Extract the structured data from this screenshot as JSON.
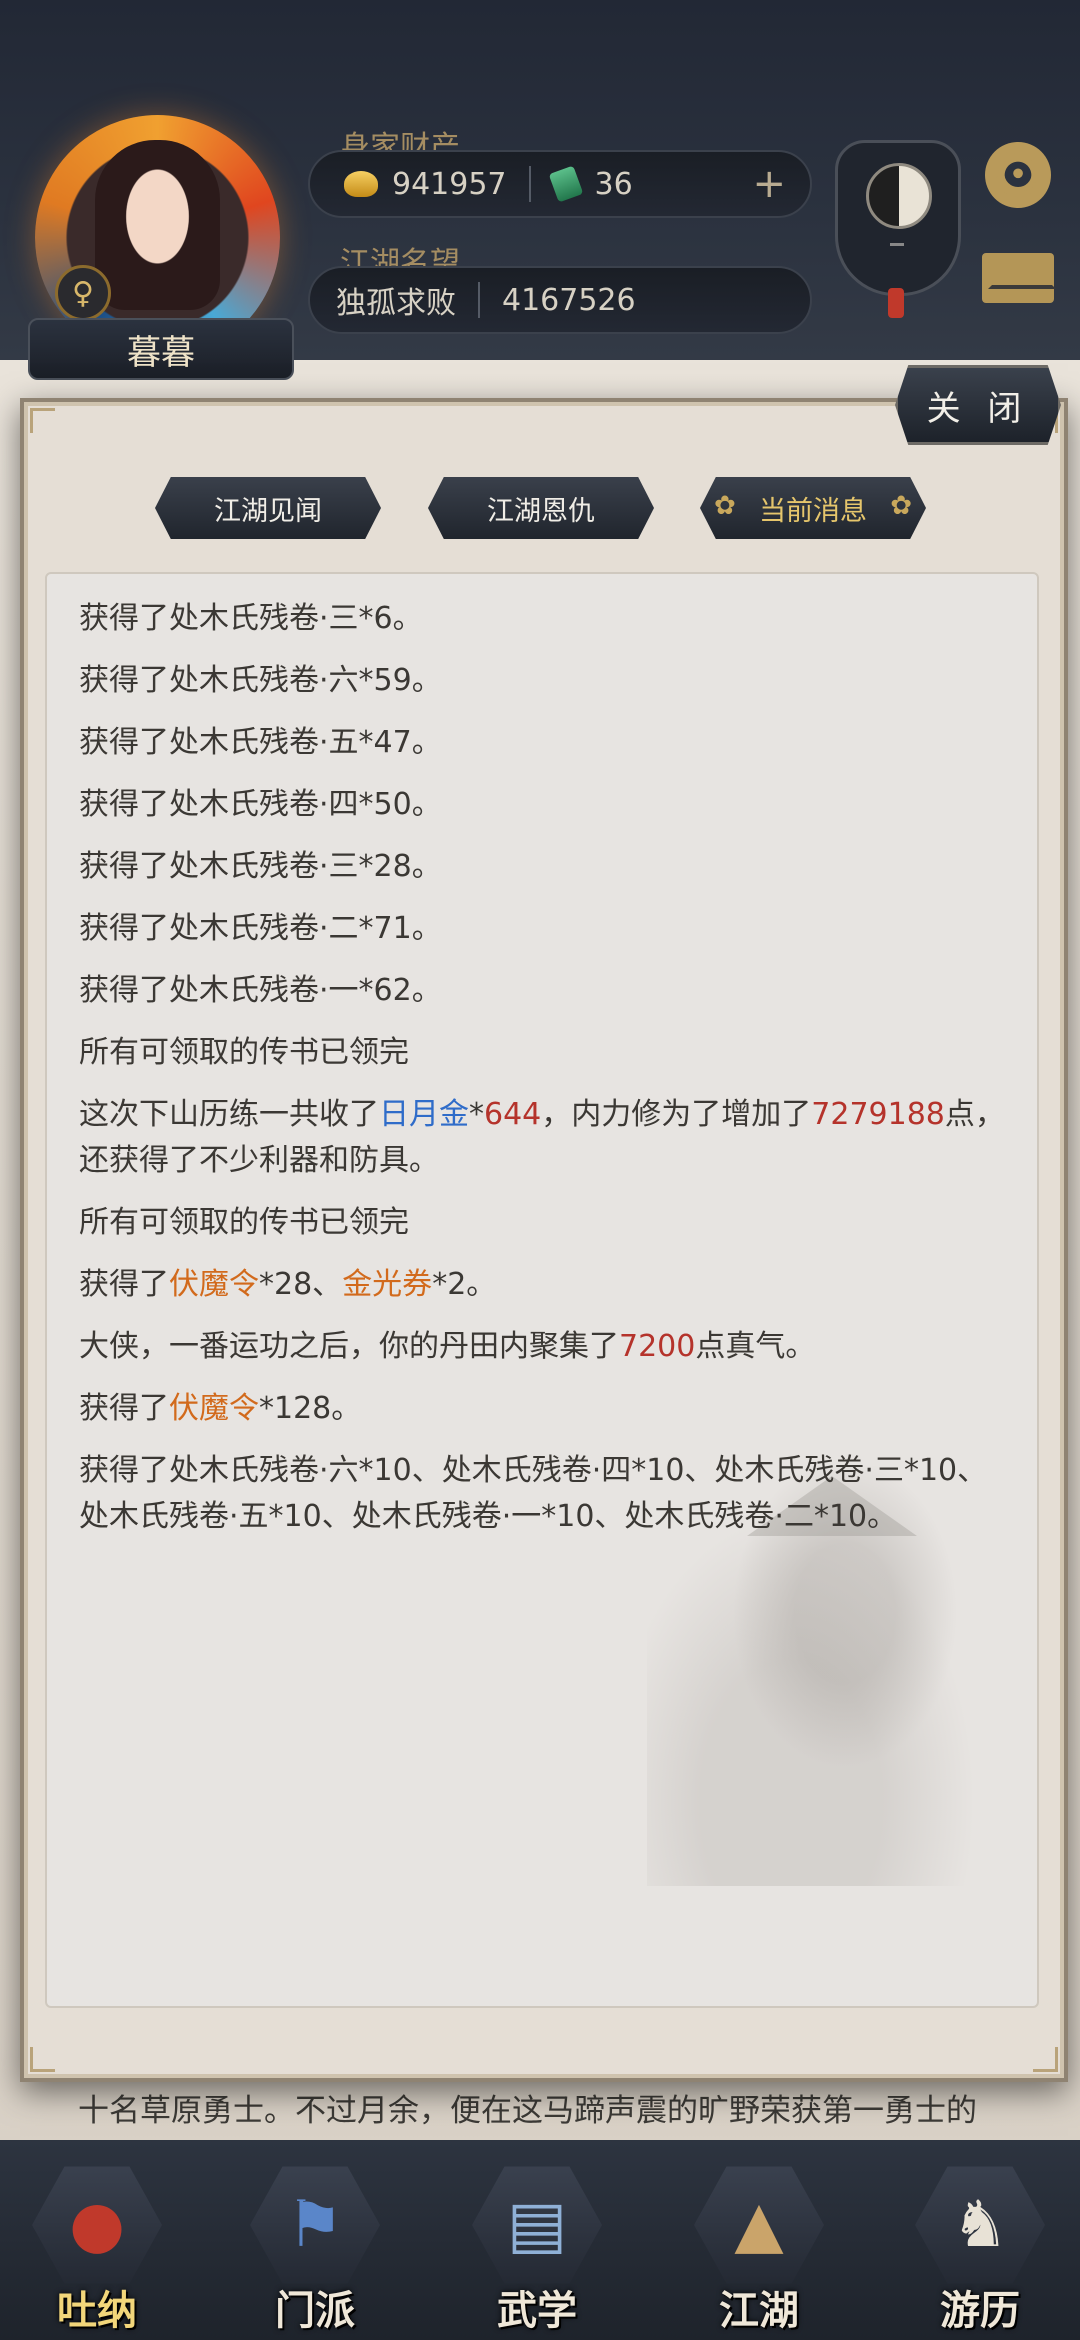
{
  "header": {
    "wealth_label": "身家财产",
    "gold": "941957",
    "jade": "36",
    "plus": "+",
    "reputation_label": "江湖名望",
    "reputation_title": "独孤求败",
    "reputation_value": "4167526",
    "player_name": "暮暮",
    "gender_symbol": "♀"
  },
  "modal": {
    "close_label": "关 闭",
    "tabs": [
      {
        "label": "江湖见闻"
      },
      {
        "label": "江湖恩仇"
      },
      {
        "label": "当前消息"
      }
    ],
    "active_tab": 2
  },
  "messages": [
    {
      "parts": [
        {
          "t": "获得了处木氏残卷·三*6。"
        }
      ]
    },
    {
      "parts": [
        {
          "t": "获得了处木氏残卷·六*59。"
        }
      ]
    },
    {
      "parts": [
        {
          "t": "获得了处木氏残卷·五*47。"
        }
      ]
    },
    {
      "parts": [
        {
          "t": "获得了处木氏残卷·四*50。"
        }
      ]
    },
    {
      "parts": [
        {
          "t": "获得了处木氏残卷·三*28。"
        }
      ]
    },
    {
      "parts": [
        {
          "t": "获得了处木氏残卷·二*71。"
        }
      ]
    },
    {
      "parts": [
        {
          "t": "获得了处木氏残卷·一*62。"
        }
      ]
    },
    {
      "parts": [
        {
          "t": "所有可领取的传书已领完"
        }
      ]
    },
    {
      "parts": [
        {
          "t": "这次下山历练一共收了"
        },
        {
          "t": "日月金",
          "c": "blue"
        },
        {
          "t": "*"
        },
        {
          "t": "644",
          "c": "red"
        },
        {
          "t": "，内力修为了增加了"
        },
        {
          "t": "7279188",
          "c": "red"
        },
        {
          "t": "点，还获得了不少利器和防具。"
        }
      ]
    },
    {
      "parts": [
        {
          "t": "所有可领取的传书已领完"
        }
      ]
    },
    {
      "parts": [
        {
          "t": "获得了"
        },
        {
          "t": "伏魔令",
          "c": "orange"
        },
        {
          "t": "*28、"
        },
        {
          "t": "金光券",
          "c": "orange"
        },
        {
          "t": "*2。"
        }
      ]
    },
    {
      "parts": [
        {
          "t": "大侠，一番运功之后，你的丹田内聚集了"
        },
        {
          "t": "7200",
          "c": "red"
        },
        {
          "t": "点真气。"
        }
      ]
    },
    {
      "parts": [
        {
          "t": "获得了"
        },
        {
          "t": "伏魔令",
          "c": "orange"
        },
        {
          "t": "*128。"
        }
      ]
    },
    {
      "parts": [
        {
          "t": "获得了处木氏残卷·六*10、处木氏残卷·四*10、处木氏残卷·三*10、处木氏残卷·五*10、处木氏残卷·一*10、处木氏残卷·二*10。"
        }
      ]
    }
  ],
  "background_text": "十名草原勇士。不过月余，便在这马蹄声震的旷野荣获第一勇士的",
  "bottom_nav": [
    {
      "label": "吐纳",
      "icon": "monk-icon",
      "active": true
    },
    {
      "label": "门派",
      "icon": "clan-flag-icon",
      "active": false
    },
    {
      "label": "武学",
      "icon": "book-icon",
      "active": false
    },
    {
      "label": "江湖",
      "icon": "straw-hat-icon",
      "active": false
    },
    {
      "label": "游历",
      "icon": "horse-icon",
      "active": false
    }
  ],
  "colors": {
    "red": "#b5332b",
    "blue": "#2f6cc9",
    "orange": "#d26a1c",
    "gold_text": "#a58d62"
  }
}
